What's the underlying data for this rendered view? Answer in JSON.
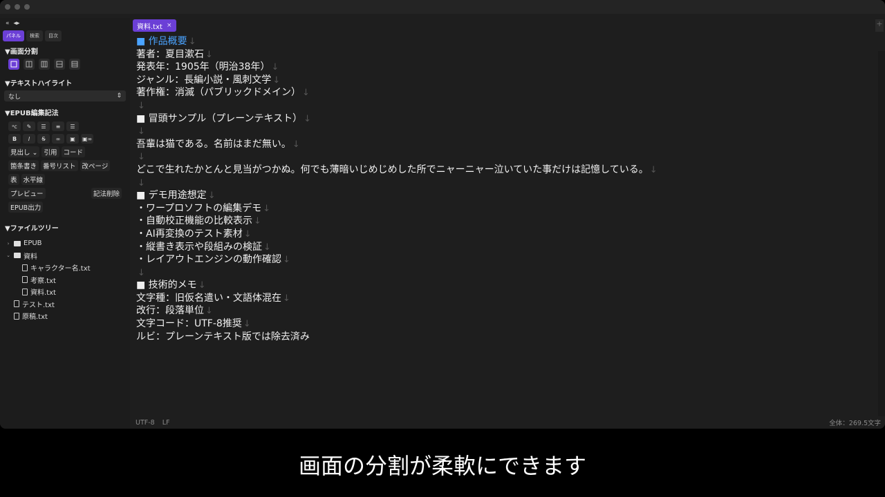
{
  "sidebar": {
    "top_icons": [
      "«",
      "◂▸"
    ],
    "tabs": [
      "パネル",
      "検索",
      "目次"
    ],
    "sections": {
      "split": "▼画面分割",
      "highlight": "▼テキストハイライト",
      "epub": "▼EPUB編集記法",
      "tree": "▼ファイルツリー"
    },
    "highlight_value": "なし",
    "epub_buttons": {
      "heading": "見出し ⌄",
      "quote": "引用",
      "code": "コード",
      "bullet": "箇条書き",
      "numbered": "番号リスト",
      "pagebreak": "改ページ",
      "table": "表",
      "hr": "水平線",
      "preview": "プレビュー",
      "delete_markup": "記法削除",
      "epub_export": "EPUB出力"
    },
    "tree": [
      {
        "label": "EPUB"
      },
      {
        "label": "資料"
      },
      {
        "label": "キャラクター名.txt"
      },
      {
        "label": "考察.txt"
      },
      {
        "label": "資料.txt"
      },
      {
        "label": "テスト.txt"
      },
      {
        "label": "原稿.txt"
      }
    ]
  },
  "editor": {
    "tab_label": "資料.txt",
    "tab_close": "×",
    "add_tab": "+",
    "lines": [
      "■ 作品概要",
      "著者：夏目漱石",
      "発表年：1905年（明治38年）",
      "ジャンル：長編小説・風刺文学",
      "著作権：消滅（パブリックドメイン）",
      "",
      "■ 冒頭サンプル（プレーンテキスト）",
      "",
      "吾輩は猫である。名前はまだ無い。",
      "",
      "どこで生れたかとんと見当がつかぬ。何でも薄暗いじめじめした所でニャーニャー泣いていた事だけは記憶している。",
      "",
      "■ デモ用途想定",
      "・ワープロソフトの編集デモ",
      "・自動校正機能の比較表示",
      "・AI再変換のテスト素材",
      "・縦書き表示や段組みの検証",
      "・レイアウトエンジンの動作確認",
      "",
      "■ 技術的メモ",
      "文字種：旧仮名遣い・文語体混在",
      "改行：段落単位",
      "文字コード：UTF-8推奨",
      "ルビ：プレーンテキスト版では除去済み"
    ],
    "return_mark": "↓"
  },
  "status": {
    "encoding": "UTF-8",
    "newline": "LF",
    "count": "全体：269.5文字"
  },
  "caption": "画面の分割が柔軟にできます",
  "colors": {
    "accent": "#6b3fd6",
    "heading_blue": "#4aa3ff"
  }
}
